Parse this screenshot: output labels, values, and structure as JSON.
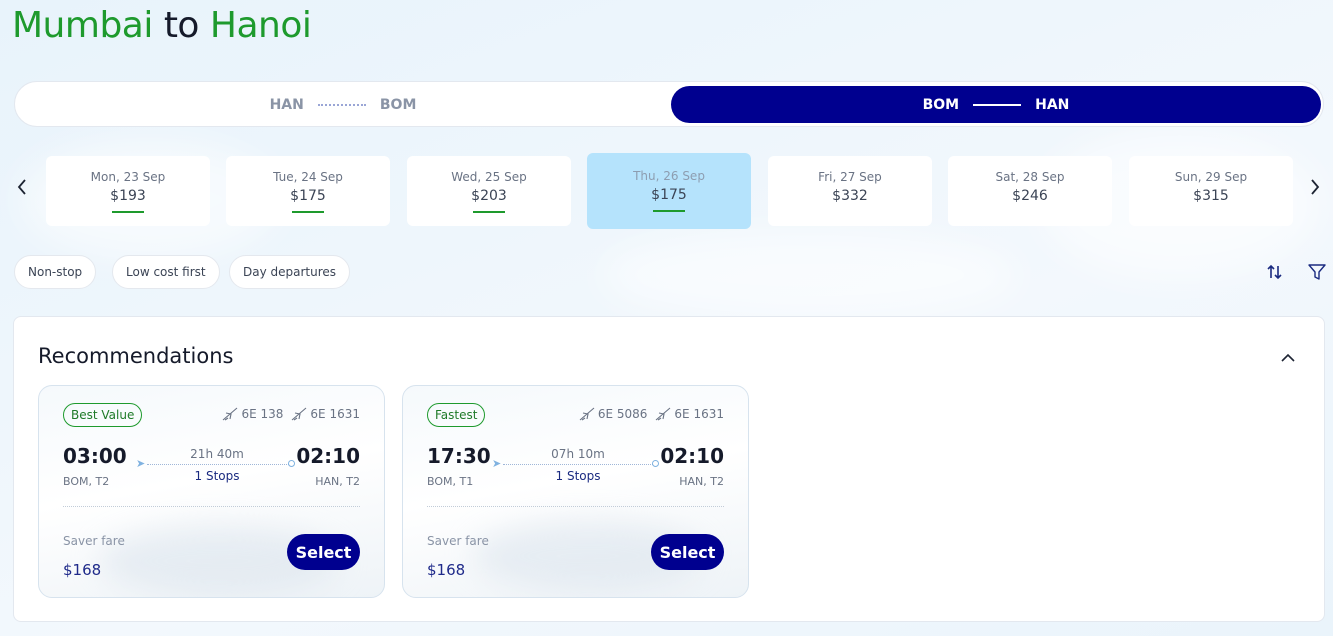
{
  "title": {
    "from": "Mumbai",
    "connector": "to",
    "to": "Hanoi"
  },
  "direction_toggle": {
    "return_leg": {
      "from": "HAN",
      "to": "BOM"
    },
    "onward_leg": {
      "from": "BOM",
      "to": "HAN"
    }
  },
  "dates": [
    {
      "label": "Mon, 23 Sep",
      "price": "$193",
      "has_bar": true
    },
    {
      "label": "Tue, 24 Sep",
      "price": "$175",
      "has_bar": true
    },
    {
      "label": "Wed, 25 Sep",
      "price": "$203",
      "has_bar": true
    },
    {
      "label": "Thu, 26 Sep",
      "price": "$175",
      "has_bar": true,
      "selected": true
    },
    {
      "label": "Fri, 27 Sep",
      "price": "$332",
      "has_bar": false
    },
    {
      "label": "Sat, 28 Sep",
      "price": "$246",
      "has_bar": false
    },
    {
      "label": "Sun, 29 Sep",
      "price": "$315",
      "has_bar": false
    }
  ],
  "filters": [
    "Non-stop",
    "Low cost first",
    "Day departures"
  ],
  "recommendations": {
    "title": "Recommendations",
    "cards": [
      {
        "badge": "Best Value",
        "flights": [
          "6E 138",
          "6E 1631"
        ],
        "depart_time": "03:00",
        "depart_port": "BOM, T2",
        "duration": "21h 40m",
        "stops": "1 Stops",
        "arrive_time": "02:10",
        "arrive_port": "HAN, T2",
        "fare_label": "Saver fare",
        "price": "$168",
        "button": "Select"
      },
      {
        "badge": "Fastest",
        "flights": [
          "6E 5086",
          "6E 1631"
        ],
        "depart_time": "17:30",
        "depart_port": "BOM, T1",
        "duration": "07h 10m",
        "stops": "1 Stops",
        "arrive_time": "02:10",
        "arrive_port": "HAN, T2",
        "fare_label": "Saver fare",
        "price": "$168",
        "button": "Select"
      }
    ]
  },
  "colors": {
    "brand_green": "#1e9a2d",
    "brand_navy": "#00008f",
    "selected_date": "#b5e3fc"
  }
}
